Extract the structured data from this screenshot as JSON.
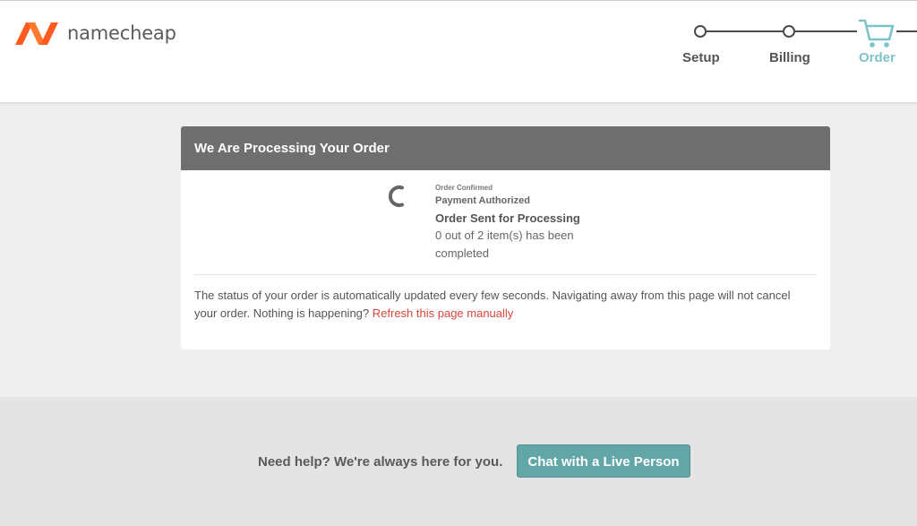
{
  "brand": {
    "name": "namecheap",
    "logo_color": "#ff5a1f"
  },
  "steps": [
    {
      "label": "Setup",
      "active": false
    },
    {
      "label": "Billing",
      "active": false
    },
    {
      "label": "Order",
      "active": true,
      "icon": "cart-icon"
    }
  ],
  "colors": {
    "accent_teal": "#63a6a8",
    "active_step": "#7ec3c9",
    "link_red": "#d9463b",
    "card_header": "#6f6f6f"
  },
  "card": {
    "title": "We Are Processing Your Order",
    "status": {
      "confirmed": "Order Confirmed",
      "authorized": "Payment Authorized",
      "sent": "Order Sent for Processing",
      "count_line": "0 out of 2 item(s) has been completed"
    },
    "note": "The status of your order is automatically updated every few seconds. Navigating away from this page will not cancel your order. Nothing is happening?",
    "refresh_link": "Refresh this page manually"
  },
  "footer": {
    "help_text": "Need help? We're always here for you.",
    "chat_button": "Chat with a Live Person"
  }
}
